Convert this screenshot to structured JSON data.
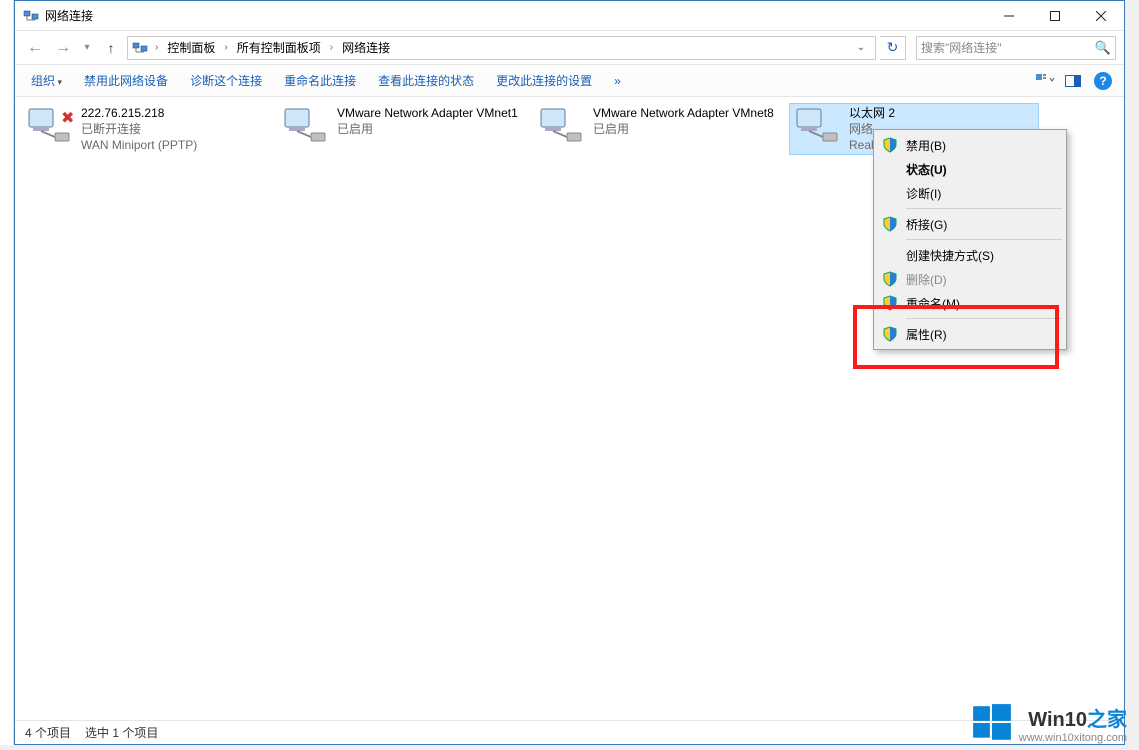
{
  "window": {
    "title": "网络连接"
  },
  "breadcrumb": {
    "items": [
      "控制面板",
      "所有控制面板项",
      "网络连接"
    ]
  },
  "search": {
    "placeholder": "搜索\"网络连接\""
  },
  "toolbar": {
    "organize": "组织",
    "disable": "禁用此网络设备",
    "diagnose": "诊断这个连接",
    "rename": "重命名此连接",
    "viewstatus": "查看此连接的状态",
    "changesettings": "更改此连接的设置"
  },
  "adapters": [
    {
      "name": "222.76.215.218",
      "status": "已断开连接",
      "device": "WAN Miniport (PPTP)"
    },
    {
      "name": "VMware Network Adapter VMnet1",
      "status": "已启用",
      "device": ""
    },
    {
      "name": "VMware Network Adapter VMnet8",
      "status": "已启用",
      "device": ""
    },
    {
      "name": "以太网 2",
      "status": "网络",
      "device": "Realte"
    }
  ],
  "context_menu": {
    "disable": "禁用(B)",
    "status": "状态(U)",
    "diagnose": "诊断(I)",
    "bridge": "桥接(G)",
    "shortcut": "创建快捷方式(S)",
    "delete": "删除(D)",
    "rename": "重命名(M)",
    "properties": "属性(R)"
  },
  "statusbar": {
    "count": "4 个项目",
    "selected": "选中 1 个项目"
  },
  "watermark": {
    "brand_main": "Win10",
    "brand_suffix": "之家",
    "url": "www.win10xitong.com"
  }
}
